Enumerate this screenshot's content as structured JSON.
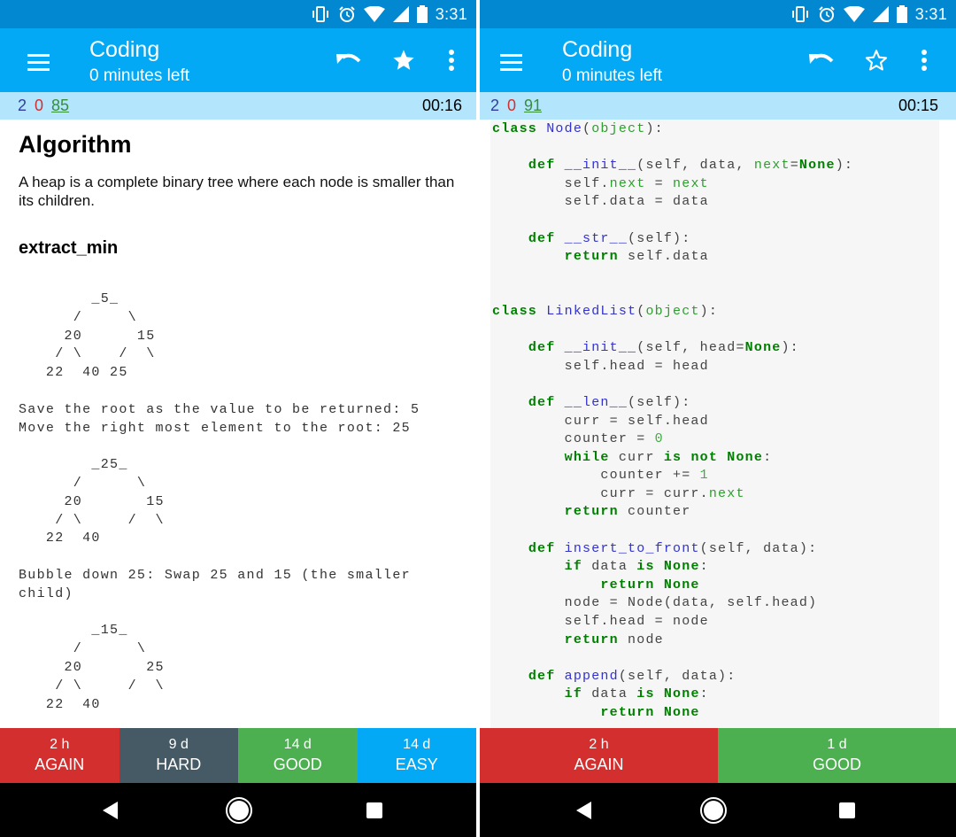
{
  "colors": {
    "status_bar": "#0288d1",
    "app_bar": "#03a9f4",
    "count_bar": "#b3e5fc",
    "count_new": "#303f9f",
    "count_learn": "#d32f2f",
    "count_review": "#388e3c",
    "again": "#d32f2f",
    "hard": "#455a64",
    "good": "#4caf50",
    "easy": "#03a9f4"
  },
  "left": {
    "status": {
      "time": "3:31",
      "icons": [
        "vibrate-icon",
        "alarm-icon",
        "wifi-icon",
        "signal-icon",
        "battery-icon"
      ]
    },
    "appbar": {
      "title": "Coding",
      "subtitle": "0 minutes left",
      "actions": [
        "undo-icon",
        "star-filled-icon",
        "more-vert-icon"
      ]
    },
    "counts": {
      "new": "2",
      "learn": "0",
      "review": "85",
      "timer": "00:16"
    },
    "card": {
      "heading": "Algorithm",
      "intro": "A heap is a complete binary tree where each node is smaller than its children.",
      "subheading": "extract_min",
      "tree1": "        _5_\n      /     \\\n     20      15\n    / \\    /  \\\n   22  40 25",
      "step1": "Save the root as the value to be returned: 5\nMove the right most element to the root: 25",
      "tree2": "        _25_\n      /      \\\n     20       15\n    / \\     /  \\\n   22  40",
      "step2": "Bubble down 25: Swap 25 and 15 (the smaller\nchild)",
      "tree3": "        _15_\n      /      \\\n     20       25\n    / \\     /  \\\n   22  40"
    },
    "answers": [
      {
        "interval": "2 h",
        "label": "AGAIN"
      },
      {
        "interval": "9 d",
        "label": "HARD"
      },
      {
        "interval": "14 d",
        "label": "GOOD"
      },
      {
        "interval": "14 d",
        "label": "EASY"
      }
    ],
    "nav": [
      "back-icon",
      "home-icon",
      "recents-icon"
    ]
  },
  "right": {
    "status": {
      "time": "3:31"
    },
    "appbar": {
      "title": "Coding",
      "subtitle": "0 minutes left",
      "actions": [
        "undo-icon",
        "star-outline-icon",
        "more-vert-icon"
      ]
    },
    "counts": {
      "new": "2",
      "learn": "0",
      "review": "91",
      "timer": "00:15"
    },
    "code_lines": [
      [
        [
          "kw",
          "class"
        ],
        [
          "t",
          " "
        ],
        [
          "nm",
          "Node"
        ],
        [
          "t",
          "("
        ],
        [
          "bi",
          "object"
        ],
        [
          "t",
          "):"
        ]
      ],
      [],
      [
        [
          "t",
          "    "
        ],
        [
          "kw",
          "def"
        ],
        [
          "t",
          " "
        ],
        [
          "nm",
          "__init__"
        ],
        [
          "t",
          "(self, data, "
        ],
        [
          "bi",
          "next"
        ],
        [
          "t",
          "="
        ],
        [
          "kw",
          "None"
        ],
        [
          "t",
          "):"
        ]
      ],
      [
        [
          "t",
          "        self."
        ],
        [
          "bi",
          "next"
        ],
        [
          "t",
          " = "
        ],
        [
          "bi",
          "next"
        ]
      ],
      [
        [
          "t",
          "        self.data = data"
        ]
      ],
      [],
      [
        [
          "t",
          "    "
        ],
        [
          "kw",
          "def"
        ],
        [
          "t",
          " "
        ],
        [
          "nm",
          "__str__"
        ],
        [
          "t",
          "(self):"
        ]
      ],
      [
        [
          "t",
          "        "
        ],
        [
          "kw",
          "return"
        ],
        [
          "t",
          " self.data"
        ]
      ],
      [],
      [],
      [
        [
          "kw",
          "class"
        ],
        [
          "t",
          " "
        ],
        [
          "nm",
          "LinkedList"
        ],
        [
          "t",
          "("
        ],
        [
          "bi",
          "object"
        ],
        [
          "t",
          "):"
        ]
      ],
      [],
      [
        [
          "t",
          "    "
        ],
        [
          "kw",
          "def"
        ],
        [
          "t",
          " "
        ],
        [
          "nm",
          "__init__"
        ],
        [
          "t",
          "(self, head="
        ],
        [
          "kw",
          "None"
        ],
        [
          "t",
          "):"
        ]
      ],
      [
        [
          "t",
          "        self.head = head"
        ]
      ],
      [],
      [
        [
          "t",
          "    "
        ],
        [
          "kw",
          "def"
        ],
        [
          "t",
          " "
        ],
        [
          "nm",
          "__len__"
        ],
        [
          "t",
          "(self):"
        ]
      ],
      [
        [
          "t",
          "        curr = self.head"
        ]
      ],
      [
        [
          "t",
          "        counter = "
        ],
        [
          "num",
          "0"
        ]
      ],
      [
        [
          "t",
          "        "
        ],
        [
          "kw",
          "while"
        ],
        [
          "t",
          " curr "
        ],
        [
          "kw",
          "is not None"
        ],
        [
          "t",
          ":"
        ]
      ],
      [
        [
          "t",
          "            counter += "
        ],
        [
          "num",
          "1"
        ]
      ],
      [
        [
          "t",
          "            curr = curr."
        ],
        [
          "bi",
          "next"
        ]
      ],
      [
        [
          "t",
          "        "
        ],
        [
          "kw",
          "return"
        ],
        [
          "t",
          " counter"
        ]
      ],
      [],
      [
        [
          "t",
          "    "
        ],
        [
          "kw",
          "def"
        ],
        [
          "t",
          " "
        ],
        [
          "nm",
          "insert_to_front"
        ],
        [
          "t",
          "(self, data):"
        ]
      ],
      [
        [
          "t",
          "        "
        ],
        [
          "kw",
          "if"
        ],
        [
          "t",
          " data "
        ],
        [
          "kw",
          "is None"
        ],
        [
          "t",
          ":"
        ]
      ],
      [
        [
          "t",
          "            "
        ],
        [
          "kw",
          "return None"
        ]
      ],
      [
        [
          "t",
          "        node = Node(data, self.head)"
        ]
      ],
      [
        [
          "t",
          "        self.head = node"
        ]
      ],
      [
        [
          "t",
          "        "
        ],
        [
          "kw",
          "return"
        ],
        [
          "t",
          " node"
        ]
      ],
      [],
      [
        [
          "t",
          "    "
        ],
        [
          "kw",
          "def"
        ],
        [
          "t",
          " "
        ],
        [
          "nm",
          "append"
        ],
        [
          "t",
          "(self, data):"
        ]
      ],
      [
        [
          "t",
          "        "
        ],
        [
          "kw",
          "if"
        ],
        [
          "t",
          " data "
        ],
        [
          "kw",
          "is None"
        ],
        [
          "t",
          ":"
        ]
      ],
      [
        [
          "t",
          "            "
        ],
        [
          "kw",
          "return None"
        ]
      ]
    ],
    "answers": [
      {
        "interval": "2 h",
        "label": "AGAIN"
      },
      {
        "interval": "1 d",
        "label": "GOOD"
      }
    ]
  }
}
